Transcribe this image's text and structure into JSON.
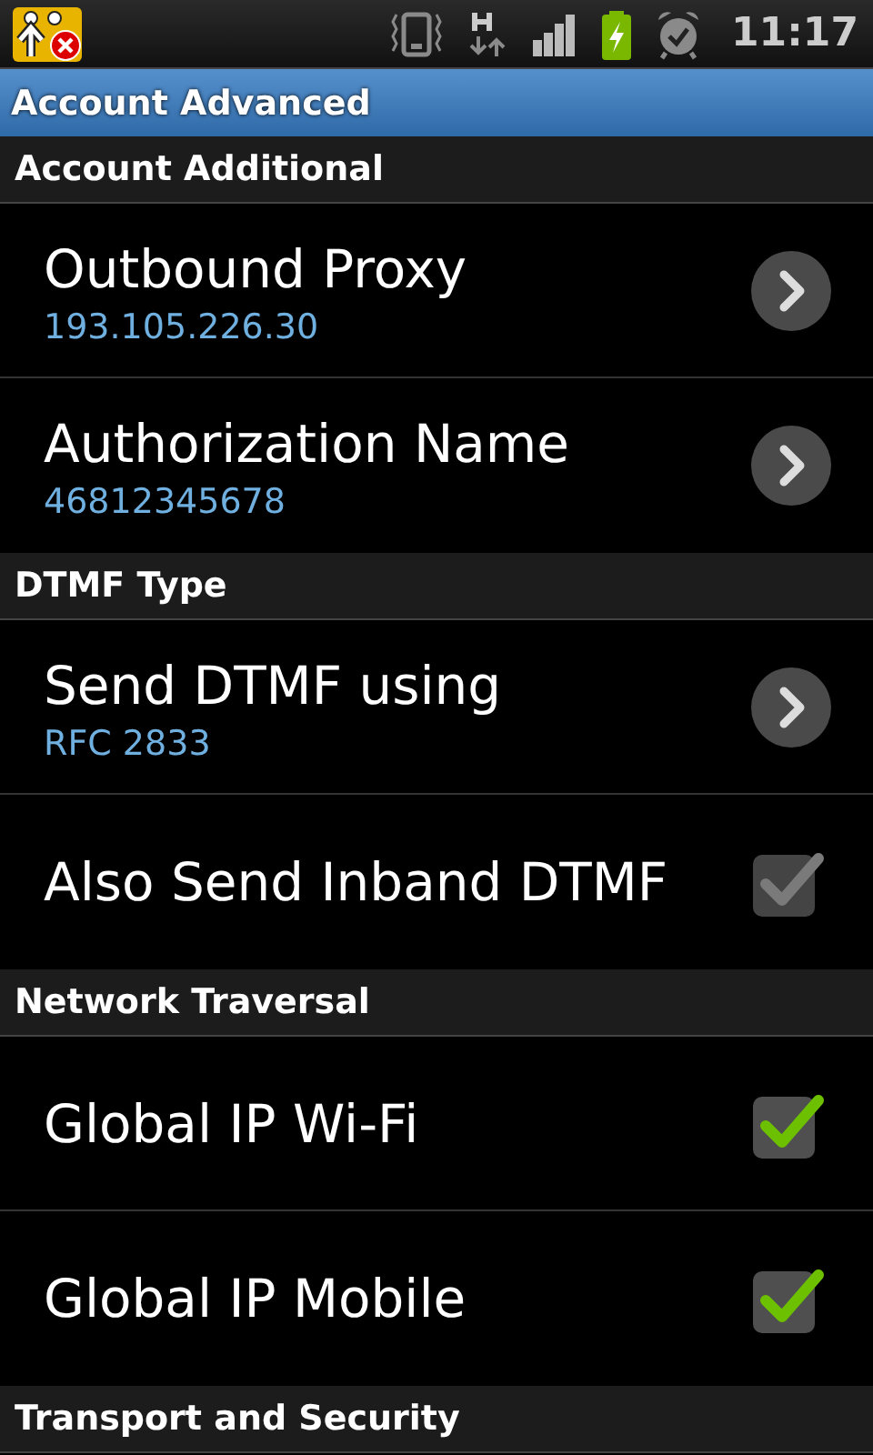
{
  "status_bar": {
    "time": "11:17"
  },
  "title_bar": {
    "title": "Account Advanced"
  },
  "sections": [
    {
      "header": "Account Additional",
      "items": [
        {
          "kind": "nav",
          "title": "Outbound Proxy",
          "summary": "193.105.226.30"
        },
        {
          "kind": "nav",
          "title": "Authorization Name",
          "summary": "46812345678"
        }
      ]
    },
    {
      "header": "DTMF Type",
      "items": [
        {
          "kind": "nav",
          "title": "Send DTMF using",
          "summary": "RFC 2833"
        },
        {
          "kind": "check",
          "title": "Also Send Inband DTMF",
          "checked": true,
          "disabled": true
        }
      ]
    },
    {
      "header": "Network Traversal",
      "items": [
        {
          "kind": "check",
          "title": "Global IP Wi-Fi",
          "checked": true,
          "disabled": false
        },
        {
          "kind": "check",
          "title": "Global IP Mobile",
          "checked": true,
          "disabled": false
        }
      ]
    },
    {
      "header": "Transport and Security"
    }
  ]
}
